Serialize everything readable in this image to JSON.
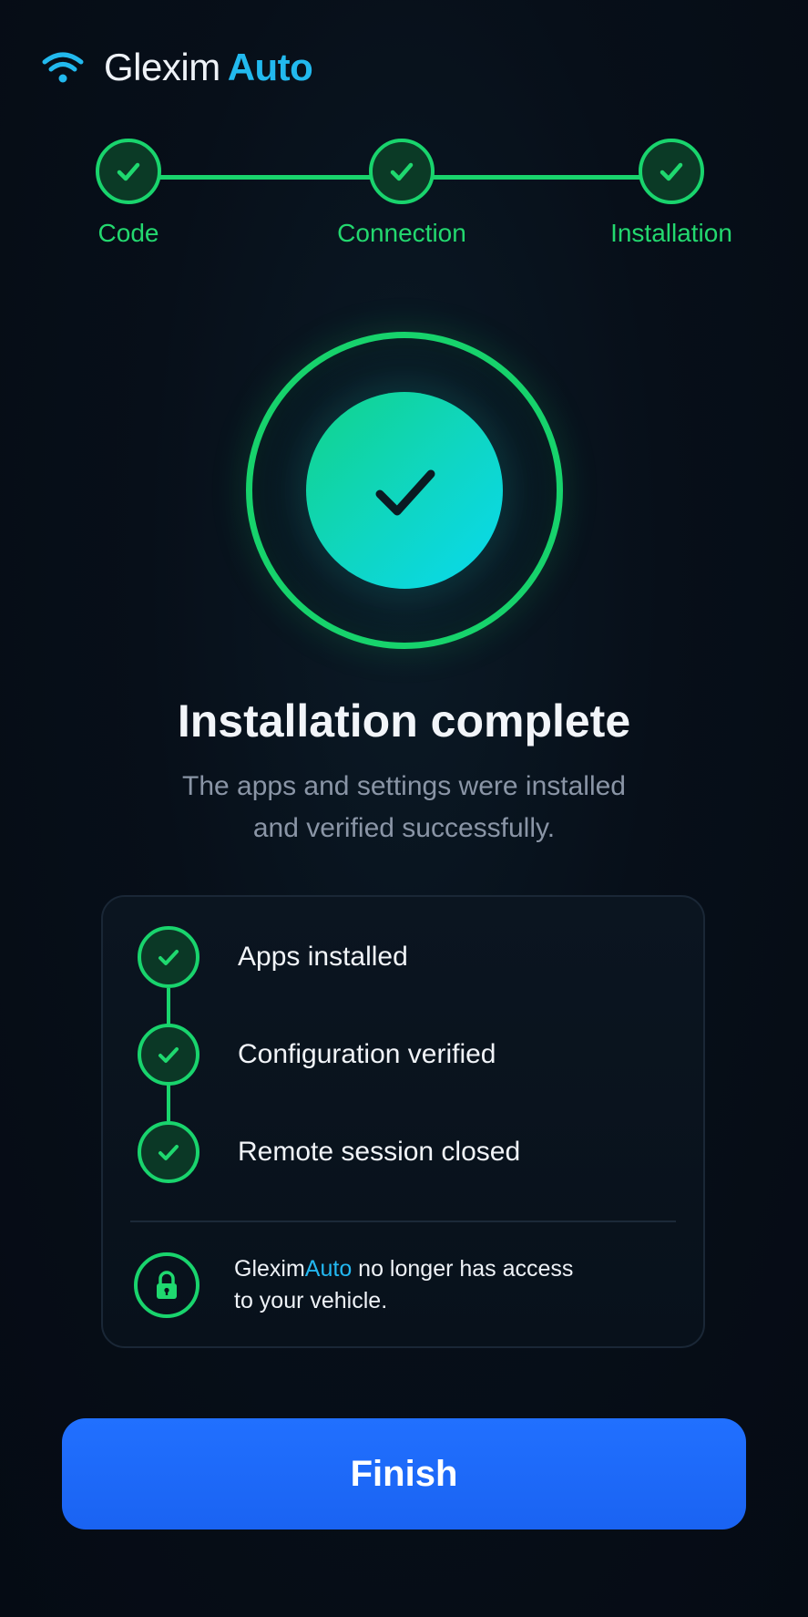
{
  "header": {
    "brand_primary": "Glexim",
    "brand_accent": "Auto",
    "icon": "wifi-icon"
  },
  "stepper": {
    "steps": [
      {
        "label": "Code",
        "status": "complete"
      },
      {
        "label": "Connection",
        "status": "complete"
      },
      {
        "label": "Installation",
        "status": "complete"
      }
    ]
  },
  "hero": {
    "icon": "check-icon"
  },
  "main": {
    "title": "Installation complete",
    "subtitle_line1": "The apps and settings were installed",
    "subtitle_line2": "and verified successfully."
  },
  "checklist": {
    "items": [
      {
        "label": "Apps installed",
        "status": "complete"
      },
      {
        "label": "Configuration verified",
        "status": "complete"
      },
      {
        "label": "Remote session closed",
        "status": "complete"
      }
    ]
  },
  "notice": {
    "brand_primary": "Glexim",
    "brand_accent": "Auto",
    "text_line1": " no longer has access",
    "text_line2": "to your vehicle.",
    "icon": "lock-icon"
  },
  "actions": {
    "finish_label": "Finish"
  },
  "colors": {
    "background": "#060d17",
    "success_green": "#19d46d",
    "brand_blue": "#22b9ee",
    "primary_button": "#1f6bfb",
    "text_primary": "#f2f5f9",
    "text_muted": "#8a95a6"
  }
}
